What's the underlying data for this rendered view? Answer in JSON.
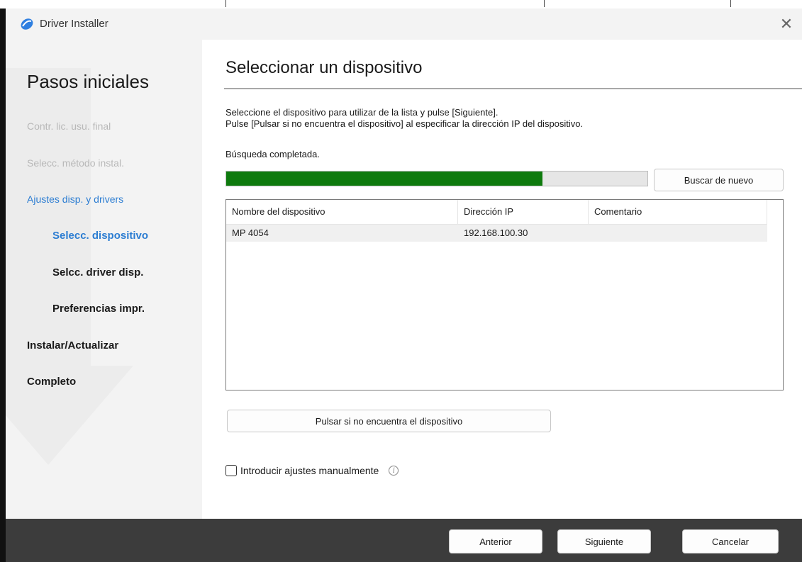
{
  "window": {
    "title": "Driver Installer",
    "close_glyph": "✕"
  },
  "sidebar": {
    "heading": "Pasos iniciales",
    "steps": [
      {
        "label": "Contr. lic. usu. final",
        "state": "done"
      },
      {
        "label": "Selecc. método instal.",
        "state": "done"
      },
      {
        "label": "Ajustes disp. y drivers",
        "state": "active"
      },
      {
        "label": "Selecc. dispositivo",
        "state": "current"
      },
      {
        "label": "Selcc. driver disp.",
        "state": "pending"
      },
      {
        "label": "Preferencias impr.",
        "state": "pending"
      },
      {
        "label": "Instalar/Actualizar",
        "state": "pending"
      },
      {
        "label": "Completo",
        "state": "pending"
      }
    ]
  },
  "main": {
    "title": "Seleccionar un dispositivo",
    "desc_line1": "Seleccione el dispositivo para utilizar de la lista y pulse [Siguiente].",
    "desc_line2": "Pulse [Pulsar si no encuentra el dispositivo] al especificar la dirección IP del dispositivo.",
    "status": "Búsqueda completada.",
    "progress_fraction": 0.75,
    "search_again_label": "Buscar de nuevo",
    "table": {
      "columns": [
        "Nombre del dispositivo",
        "Dirección IP",
        "Comentario"
      ],
      "rows": [
        {
          "name": "MP 4054",
          "ip": "192.168.100.30",
          "comment": ""
        }
      ]
    },
    "not_found_label": "Pulsar si no encuentra el dispositivo",
    "manual_label": "Introducir ajustes manualmente",
    "manual_checked": false,
    "info_glyph": "i"
  },
  "footer": {
    "back_label": "Anterior",
    "next_label": "Siguiente",
    "cancel_label": "Cancelar"
  },
  "colors": {
    "accent": "#2c7dd2",
    "progress": "#0e7a0d",
    "footer": "#3c3c3c"
  }
}
